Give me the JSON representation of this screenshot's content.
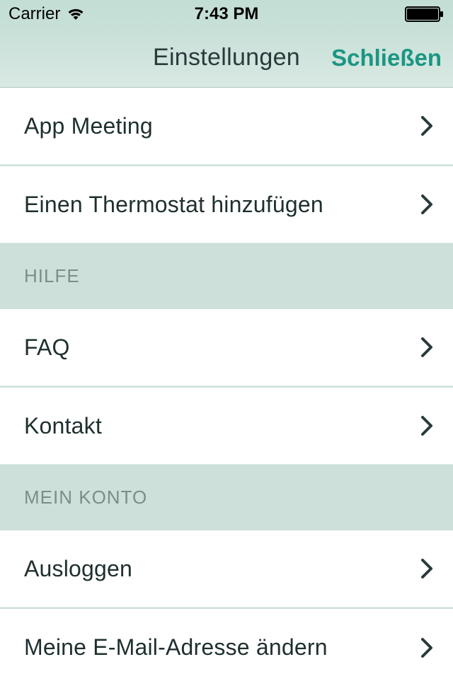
{
  "status": {
    "carrier": "Carrier",
    "time": "7:43 PM"
  },
  "nav": {
    "title": "Einstellungen",
    "close": "Schließen"
  },
  "sections": {
    "top": {
      "items": [
        {
          "label": "App Meeting"
        },
        {
          "label": "Einen Thermostat hinzufügen"
        }
      ]
    },
    "help": {
      "header": "HILFE",
      "items": [
        {
          "label": "FAQ"
        },
        {
          "label": "Kontakt"
        }
      ]
    },
    "account": {
      "header": "MEIN KONTO",
      "items": [
        {
          "label": "Ausloggen"
        },
        {
          "label": "Meine E-Mail-Adresse ändern"
        }
      ]
    }
  }
}
